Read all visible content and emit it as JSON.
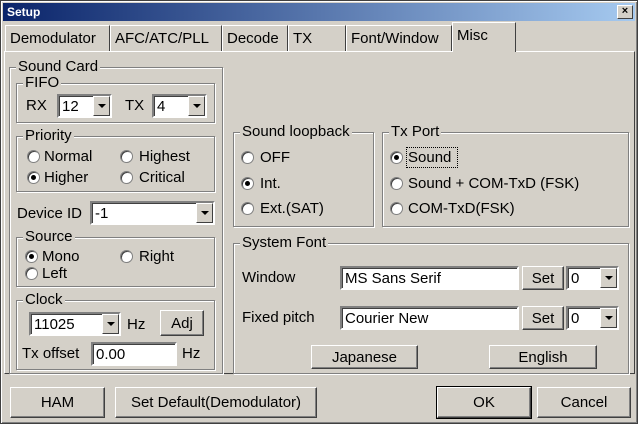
{
  "window": {
    "title": "Setup",
    "close_glyph": "×"
  },
  "tabs": [
    {
      "label": "Demodulator"
    },
    {
      "label": "AFC/ATC/PLL"
    },
    {
      "label": "Decode"
    },
    {
      "label": "TX"
    },
    {
      "label": "Font/Window"
    },
    {
      "label": "Misc",
      "active": true
    }
  ],
  "sound_card": {
    "legend": "Sound Card",
    "fifo": {
      "legend": "FIFO",
      "rx_label": "RX",
      "rx_value": "12",
      "tx_label": "TX",
      "tx_value": "4"
    },
    "priority": {
      "legend": "Priority",
      "options": [
        "Normal",
        "Highest",
        "Higher",
        "Critical"
      ],
      "selected": "Higher"
    },
    "device_id": {
      "label": "Device ID",
      "value": "-1"
    },
    "source": {
      "legend": "Source",
      "options": [
        "Mono",
        "Right",
        "Left"
      ],
      "selected": "Mono"
    },
    "clock": {
      "legend": "Clock",
      "value": "11025",
      "unit": "Hz",
      "adj_label": "Adj",
      "tx_offset_label": "Tx offset",
      "tx_offset_value": "0.00",
      "tx_offset_unit": "Hz"
    }
  },
  "sound_loopback": {
    "legend": "Sound loopback",
    "options": [
      "OFF",
      "Int.",
      "Ext.(SAT)"
    ],
    "selected": "Int."
  },
  "tx_port": {
    "legend": "Tx Port",
    "options": [
      "Sound",
      "Sound + COM-TxD (FSK)",
      "COM-TxD(FSK)"
    ],
    "selected": "Sound"
  },
  "system_font": {
    "legend": "System Font",
    "window_label": "Window",
    "window_font": "MS Sans Serif",
    "window_set": "Set",
    "window_charset": "0",
    "fixed_label": "Fixed pitch",
    "fixed_font": "Courier New",
    "fixed_set": "Set",
    "fixed_charset": "0",
    "japanese_label": "Japanese",
    "english_label": "English"
  },
  "footer": {
    "ham": "HAM",
    "set_default": "Set Default(Demodulator)",
    "ok": "OK",
    "cancel": "Cancel"
  }
}
